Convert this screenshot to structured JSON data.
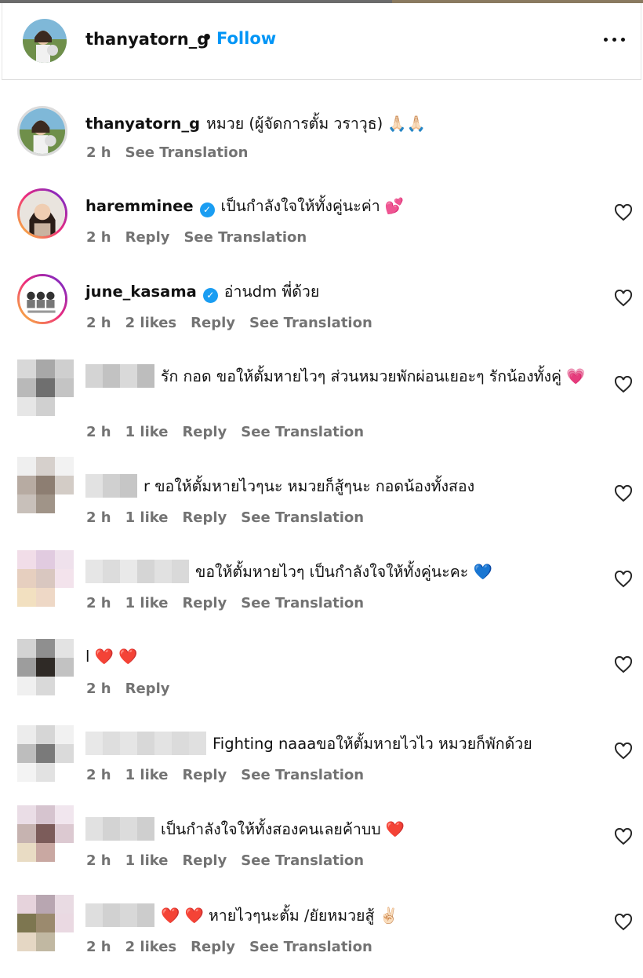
{
  "header": {
    "username": "thanyatorn_g",
    "separator": "•",
    "follow_label": "Follow",
    "more_icon": "more-horizontal-icon"
  },
  "comments": [
    {
      "user": "thanyatorn_g",
      "text": "หมวย (ผู้จัดการตั้ม วราวุธ) 🙏🏻🙏🏻",
      "time": "2 h",
      "likes": "",
      "reply": "",
      "translate": "See Translation",
      "verified": false
    },
    {
      "user": "haremminee",
      "text": "เป็นกำลังใจให้ทั้งคู่นะค่า 💕",
      "time": "2 h",
      "likes": "",
      "reply": "Reply",
      "translate": "See Translation",
      "verified": true
    },
    {
      "user": "june_kasama",
      "text": "อ่านdm พี่ด้วย",
      "time": "2 h",
      "likes": "2 likes",
      "reply": "Reply",
      "translate": "See Translation",
      "verified": true
    },
    {
      "user": "",
      "text": "รัก กอด ขอให้ตั้มหายไวๆ ส่วนหมวยพักผ่อนเยอะๆ รักน้องทั้งคู่ 💗",
      "time": "2 h",
      "likes": "1 like",
      "reply": "Reply",
      "translate": "See Translation"
    },
    {
      "user": "",
      "text": "r ขอให้ตั้มหายไวๆนะ หมวยก็สู้ๆนะ กอดน้องทั้งสอง",
      "time": "2 h",
      "likes": "1 like",
      "reply": "Reply",
      "translate": "See Translation"
    },
    {
      "user": "",
      "text": "ขอให้ตั้มหายไวๆ เป็นกำลังใจให้ทั้งคู่นะคะ 💙",
      "time": "2 h",
      "likes": "1 like",
      "reply": "Reply",
      "translate": "See Translation"
    },
    {
      "user": "",
      "text": "l ❤️ ❤️",
      "time": "2 h",
      "likes": "",
      "reply": "Reply",
      "translate": ""
    },
    {
      "user": "",
      "text": "Fighting naaaขอให้ตั้มหายไวไว หมวยก็พักด้วย",
      "time": "2 h",
      "likes": "1 like",
      "reply": "Reply",
      "translate": "See Translation"
    },
    {
      "user": "",
      "text": "เป็นกำลังใจให้ทั้งสองคนเลยค้าบบ ❤️",
      "time": "2 h",
      "likes": "1 like",
      "reply": "Reply",
      "translate": "See Translation"
    },
    {
      "user": "",
      "text": "❤️ ❤️ หายไวๆนะตั้ม /ยัยหมวยสู้ ✌🏻",
      "time": "2 h",
      "likes": "2 likes",
      "reply": "Reply",
      "translate": "See Translation"
    }
  ],
  "colors": {
    "accent": "#0095f6",
    "verified": "#1a9df2",
    "meta": "#737373"
  }
}
